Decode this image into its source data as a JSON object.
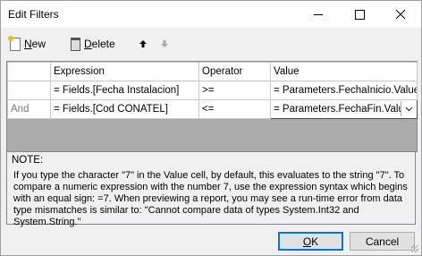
{
  "window": {
    "title": "Edit Filters"
  },
  "toolbar": {
    "new_mnemonic": "N",
    "new_rest": "ew",
    "delete_mnemonic": "D",
    "delete_rest": "elete"
  },
  "grid": {
    "columns": [
      "Expression",
      "Operator",
      "Value"
    ],
    "rows": [
      {
        "and_or": "",
        "expression": "= Fields.[Fecha Instalacion]",
        "operator": ">=",
        "value": "= Parameters.FechaInicio.Value"
      },
      {
        "and_or": "And",
        "expression": "= Fields.[Cod CONATEL]",
        "operator": "<=",
        "value": "= Parameters.FechaFin.Value"
      }
    ]
  },
  "note": {
    "title": "NOTE:",
    "text": "If you type the character \"7\" in the Value cell, by default, this evaluates to the string \"7\". To compare a numeric expression with the number 7, use the expression syntax which begins with an equal sign: =7. When previewing a report, you may see a run-time error from data type mismatches is similar to: \"Cannot compare data of types System.Int32 and System.String.\""
  },
  "buttons": {
    "ok_mnemonic": "O",
    "ok_rest": "K",
    "cancel_label": "Cancel"
  },
  "icons": {
    "new": "new-document-icon",
    "delete": "trash-icon",
    "move_up": "arrow-up-icon",
    "move_down": "arrow-down-icon",
    "minimize": "minimize-icon",
    "maximize": "maximize-icon",
    "close": "close-icon",
    "dropdown": "chevron-down-icon"
  }
}
